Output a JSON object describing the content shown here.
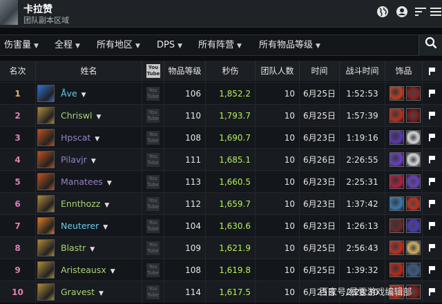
{
  "header": {
    "title": "卡拉赞",
    "subtitle": "团队副本区域",
    "icons": [
      "globe-icon",
      "user-icon",
      "sort-icon",
      "menu-icon"
    ]
  },
  "filters": [
    {
      "label": "伤害量"
    },
    {
      "label": "全程"
    },
    {
      "label": "所有地区"
    },
    {
      "label": "DPS"
    },
    {
      "label": "所有阵营"
    },
    {
      "label": "所有物品等级"
    }
  ],
  "table": {
    "columns": {
      "rank": "名次",
      "name": "姓名",
      "video": "You Tube",
      "ilvl": "物品等级",
      "dps": "秒伤",
      "raid_size": "团队人数",
      "date": "时间",
      "duration": "战斗时间",
      "trinkets": "饰品"
    },
    "rows": [
      {
        "rank": "1",
        "name": "Åve",
        "name_color": "#69ccf0",
        "spec_color": "#2f6fd6",
        "ilvl": "106",
        "dps": "1,852.2",
        "raid": "10",
        "date": "6月25日",
        "time": "1:52:53",
        "t1": "#c04020",
        "t2": "#8a2020"
      },
      {
        "rank": "2",
        "name": "Chriswl",
        "name_color": "#abd473",
        "spec_color": "#b08a3a",
        "ilvl": "110",
        "dps": "1,793.7",
        "raid": "10",
        "date": "6月25日",
        "time": "1:57:39",
        "t1": "#b83020",
        "t2": "#7a1a1a"
      },
      {
        "rank": "3",
        "name": "Hpscat",
        "name_color": "#9482c9",
        "spec_color": "#c0501c",
        "ilvl": "108",
        "dps": "1,690.7",
        "raid": "10",
        "date": "6月23日",
        "time": "1:19:16",
        "t1": "#5a3ab0",
        "t2": "#d8d8d8"
      },
      {
        "rank": "4",
        "name": "Pilavjr",
        "name_color": "#9482c9",
        "spec_color": "#c0501c",
        "ilvl": "111",
        "dps": "1,685.1",
        "raid": "10",
        "date": "6月26日",
        "time": "2:26:55",
        "t1": "#6a40c0",
        "t2": "#d8d8d8"
      },
      {
        "rank": "5",
        "name": "Manatees",
        "name_color": "#9482c9",
        "spec_color": "#c0501c",
        "ilvl": "113",
        "dps": "1,660.5",
        "raid": "10",
        "date": "6月23日",
        "time": "2:25:31",
        "t1": "#b02040",
        "t2": "#6a40c0"
      },
      {
        "rank": "6",
        "name": "Ennthozz",
        "name_color": "#abd473",
        "spec_color": "#b08a3a",
        "ilvl": "112",
        "dps": "1,659.7",
        "raid": "10",
        "date": "6月23日",
        "time": "1:37:42",
        "t1": "#3a7ab0",
        "t2": "#c03020"
      },
      {
        "rank": "7",
        "name": "Neuterer",
        "name_color": "#69ccf0",
        "spec_color": "#e07a20",
        "ilvl": "104",
        "dps": "1,630.6",
        "raid": "10",
        "date": "6月23日",
        "time": "1:26:13",
        "t1": "#6a2a2a",
        "t2": "#4a3ab8"
      },
      {
        "rank": "8",
        "name": "Blastr",
        "name_color": "#abd473",
        "spec_color": "#b08a3a",
        "ilvl": "109",
        "dps": "1,621.9",
        "raid": "10",
        "date": "6月25日",
        "time": "2:56:43",
        "t1": "#c03020",
        "t2": "#d0b060"
      },
      {
        "rank": "9",
        "name": "Aristeausx",
        "name_color": "#abd473",
        "spec_color": "#b08a3a",
        "ilvl": "108",
        "dps": "1,619.8",
        "raid": "10",
        "date": "6月25日",
        "time": "1:39:32",
        "t1": "#b82a1a",
        "t2": "#3a5a8a"
      },
      {
        "rank": "10",
        "name": "Gravest",
        "name_color": "#abd473",
        "spec_color": "#b08a3a",
        "ilvl": "114",
        "dps": "1,617.5",
        "raid": "10",
        "date": "6月25日",
        "time": "2:28:30",
        "t1": "#b83020",
        "t2": "#7a1a1a"
      }
    ]
  },
  "watermark": "百家号/暴雪游戏编辑部"
}
